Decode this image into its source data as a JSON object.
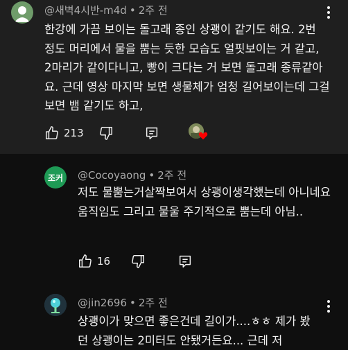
{
  "comments": [
    {
      "author": "@새벽4시반-m4d",
      "time": "2주 전",
      "text": "한강에 가끔 보이는 돌고래 종인 상괭이 같기도 해요. 2번 정도 머리에서 물을 뿜는 듯한 모습도 얼핏보이는 거 같고, 2마리가 같이다니고, 빵이 크다는 거 보면 돌고래 종류같아요. 근데 영상 마지막 보면 생물체가 엄청 길어보이는데 그걸 보면 뱀 같기도 하고,",
      "likes": "213"
    },
    {
      "author": "@Cocoyaong",
      "time": "2주 전",
      "avatar_text": "조커",
      "text": "저도 물뿜는거살짝보여서 상괭이생각했는데 아니네요 움직임도 그리고 물울 주기적으로 뿜는데 아님..",
      "likes": "16"
    },
    {
      "author": "@jin2696",
      "time": "2주 전",
      "text": "상괭이가 맞으면 좋은건데 길이가....ㅎㅎ 제가 봤던 상괭이는 2미터도 안됐거든요... 근데 저"
    }
  ],
  "separator": "•",
  "colors": {
    "c1_avatar": "#6f9c6a",
    "c2_avatar": "#1e9a55",
    "c3_avatar": "#2b4a5a",
    "heart": "#ff0000"
  }
}
